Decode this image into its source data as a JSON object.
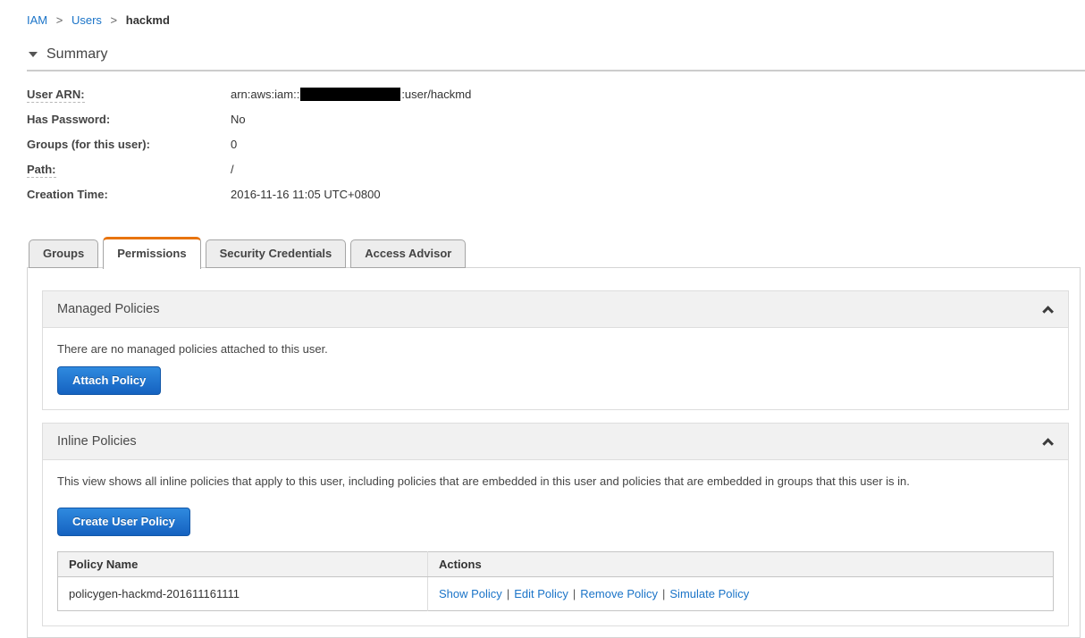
{
  "breadcrumb": {
    "separator": ">",
    "items": [
      {
        "label": "IAM"
      },
      {
        "label": "Users"
      },
      {
        "label": "hackmd"
      }
    ]
  },
  "summary": {
    "title": "Summary",
    "fields": [
      {
        "label": "User ARN:",
        "value": ""
      },
      {
        "label": "Has Password:",
        "value": "No"
      },
      {
        "label": "Groups (for this user):",
        "value": "0"
      },
      {
        "label": "Path:",
        "value": "/"
      },
      {
        "label": "Creation Time:",
        "value": "2016-11-16 11:05 UTC+0800"
      }
    ],
    "user_arn": {
      "prefix": "arn:aws:iam::",
      "redacted_account_id": "redacted",
      "suffix": ":user/hackmd"
    }
  },
  "tabs": [
    {
      "label": "Groups",
      "active": false
    },
    {
      "label": "Permissions",
      "active": true
    },
    {
      "label": "Security Credentials",
      "active": false
    },
    {
      "label": "Access Advisor",
      "active": false
    }
  ],
  "managed_policies": {
    "title": "Managed Policies",
    "collapse_icon": "chevron-up",
    "empty_message": "There are no managed policies attached to this user.",
    "attach_button": "Attach Policy"
  },
  "inline_policies": {
    "title": "Inline Policies",
    "collapse_icon": "chevron-up",
    "description": "This view shows all inline policies that apply to this user, including policies that are embedded in this user and policies that are embedded in groups that this user is in.",
    "create_button": "Create User Policy",
    "table": {
      "headers": [
        "Policy Name",
        "Actions"
      ],
      "action_separator": "|",
      "rows": [
        {
          "policy_name": "policygen-hackmd-201611161111",
          "actions": [
            "Show Policy",
            "Edit Policy",
            "Remove Policy",
            "Simulate Policy"
          ]
        }
      ]
    }
  },
  "colors": {
    "accent_orange": "#e8740f",
    "link_blue": "#1b74c8",
    "button_blue_top": "#2f8adf",
    "button_blue_bottom": "#1562c0",
    "panel_header_bg": "#f1f1f1"
  }
}
